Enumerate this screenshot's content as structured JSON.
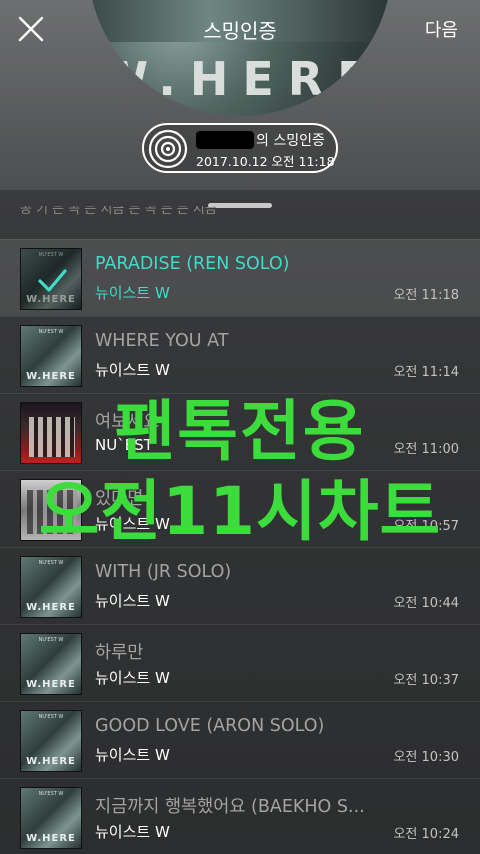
{
  "header": {
    "title": "스밍인증",
    "next_label": "다음",
    "cover_text": "W.HERE",
    "badge_line1": "의 스밍인증",
    "badge_line2": "2017.10.12 오전 11:18"
  },
  "list": {
    "partial_text": "공 기 는 곡 는 지금 는 곡 는 는 지금",
    "rows": [
      {
        "title": "PARADISE (REN SOLO)",
        "artist": "뉴이스트 W",
        "time": "오전 11:18",
        "cover": "where",
        "selected": true
      },
      {
        "title": "WHERE YOU AT",
        "artist": "뉴이스트 W",
        "time": "오전 11:14",
        "cover": "where",
        "selected": false
      },
      {
        "title": "여보세요",
        "artist": "NU`EST",
        "time": "오전 11:00",
        "cover": "live",
        "selected": false
      },
      {
        "title": "있다면",
        "artist": "뉴이스트 W",
        "time": "오전 10:57",
        "cover": "group",
        "selected": false
      },
      {
        "title": "WITH (JR SOLO)",
        "artist": "뉴이스트 W",
        "time": "오전 10:44",
        "cover": "where",
        "selected": false
      },
      {
        "title": "하루만",
        "artist": "뉴이스트 W",
        "time": "오전 10:37",
        "cover": "where",
        "selected": false
      },
      {
        "title": "GOOD LOVE (ARON SOLO)",
        "artist": "뉴이스트 W",
        "time": "오전 10:30",
        "cover": "where",
        "selected": false
      },
      {
        "title": "지금까지 행복했어요 (BAEKHO S...",
        "artist": "뉴이스트 W",
        "time": "오전 10:24",
        "cover": "where",
        "selected": false
      }
    ],
    "thumb_small_text": "NU'EST W",
    "thumb_cover_text": "W.HERE"
  },
  "overlay": {
    "line1": "팬톡전용",
    "line2": "오전11시차트"
  },
  "colors": {
    "accent": "#3fdcca",
    "overlay_green": "#3ddc3d"
  },
  "icons": {
    "close": "close-icon",
    "disc": "disc-icon",
    "check": "check-icon"
  }
}
